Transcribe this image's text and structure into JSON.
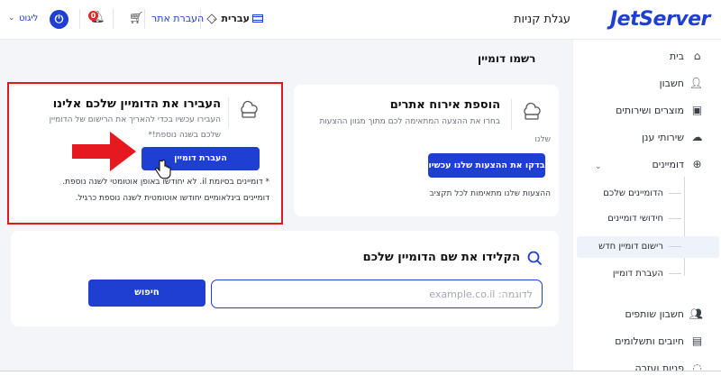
{
  "header": {
    "logo": "JetServer",
    "page_title": "עגלת קניות",
    "language": "עברית",
    "transfer_site": "העברת אתר",
    "notifications_count": "0",
    "logout": "ליגוט"
  },
  "sidebar": {
    "items": [
      {
        "label": "בית",
        "icon": "home-icon"
      },
      {
        "label": "חשבון",
        "icon": "user-icon"
      },
      {
        "label": "מוצרים ושירותים",
        "icon": "products-icon"
      },
      {
        "label": "שירותי ענן",
        "icon": "cloud-icon"
      },
      {
        "label": "דומיינים",
        "icon": "globe-icon"
      }
    ],
    "sub_items": [
      {
        "label": "הדומיינים שלכם"
      },
      {
        "label": "חידושי דומיינים"
      },
      {
        "label": "רישום דומיין חדש",
        "active": true
      },
      {
        "label": "העברת דומיין"
      }
    ],
    "bottom_items": [
      {
        "label": "חשבון שותפים",
        "icon": "partners-icon"
      },
      {
        "label": "חיובים ותשלומים",
        "icon": "billing-icon"
      },
      {
        "label": "פניות ועזרה",
        "icon": "support-icon"
      }
    ]
  },
  "main": {
    "section_title": "רשמו דומיין",
    "hosting_card": {
      "title": "הוספת אירוח אתרים",
      "subtitle_line1": "בחרו את ההצעה המתאימה לכם מתוך מגוון ההצעות",
      "subtitle_line2": "שלנו",
      "button": "בדקו את ההצעות שלנו עכשיו",
      "note": "ההצעות שלנו מתאימות לכל תקציב"
    },
    "transfer_card": {
      "title": "העבירו את הדומיין שלכם אלינו",
      "subtitle_line1": "העבירו עכשיו בכדי להאריך את הרישום של הדומיין",
      "subtitle_line2": "שלכם בשנה נוספת!*",
      "button": "העברת דומיין",
      "note_line1": "* דומיינים בסיומת il. לא יחודשו באופן אוטומטי לשנה נוספת.",
      "note_line2": "דומיינים בינלאומיים יחודשו אוטומטית לשנה נוספת כרגיל."
    },
    "search": {
      "title": "הקלידו את שם הדומיין שלכם",
      "placeholder": "לדוגמה: example.co.il",
      "button": "חיפוש"
    }
  },
  "colors": {
    "accent": "#1e3fd1",
    "highlight": "#e0181f",
    "background": "#f3f5f8"
  }
}
